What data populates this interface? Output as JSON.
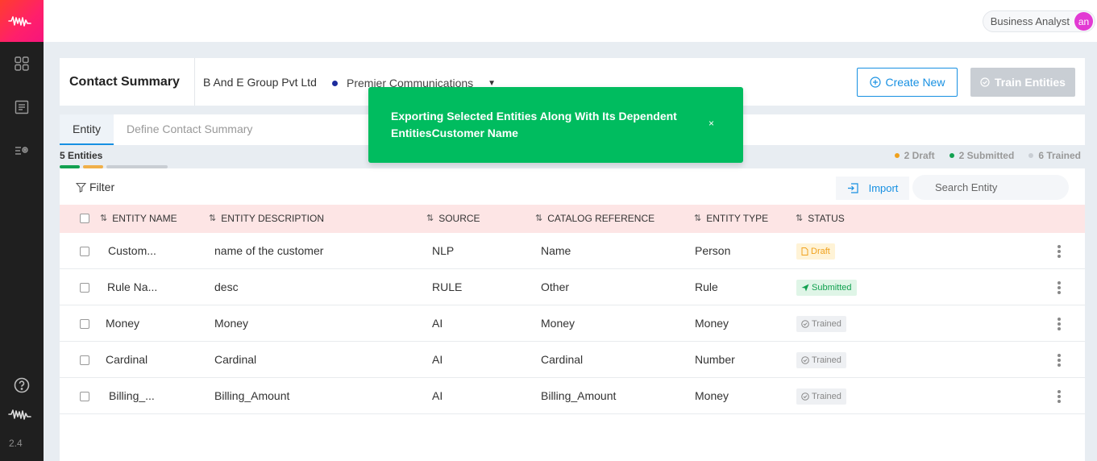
{
  "app": {
    "version": "2.4",
    "user_role": "Business Analyst",
    "avatar_initials": "an"
  },
  "header": {
    "title": "Contact Summary",
    "company": "B And E Group Pvt Ltd",
    "project": "Premier Communications",
    "create_label": "Create New",
    "train_label": "Train Entities"
  },
  "tabs": [
    {
      "label": "Entity",
      "active": true
    },
    {
      "label": "Define Contact Summary",
      "active": false
    }
  ],
  "stats": {
    "entities_label": "5 Entities",
    "draft_label": "2 Draft",
    "submitted_label": "2 Submitted",
    "trained_label": "6 Trained"
  },
  "toolbar": {
    "filter_label": "Filter",
    "import_label": "Import",
    "search_placeholder": "Search Entity"
  },
  "table": {
    "headers": [
      "ENTITY NAME",
      "ENTITY DESCRIPTION",
      "SOURCE",
      "CATALOG REFERENCE",
      "ENTITY TYPE",
      "STATUS"
    ],
    "rows": [
      {
        "name": "Custom...",
        "description": "name of the customer",
        "source": "NLP",
        "catalog": "Name",
        "type": "Person",
        "status": "Draft"
      },
      {
        "name": "Rule Na...",
        "description": "desc",
        "source": "RULE",
        "catalog": "Other",
        "type": "Rule",
        "status": "Submitted"
      },
      {
        "name": "Money",
        "description": "Money",
        "source": "AI",
        "catalog": "Money",
        "type": "Money",
        "status": "Trained"
      },
      {
        "name": "Cardinal",
        "description": "Cardinal",
        "source": "AI",
        "catalog": "Cardinal",
        "type": "Number",
        "status": "Trained"
      },
      {
        "name": "Billing_...",
        "description": "Billing_Amount",
        "source": "AI",
        "catalog": "Billing_Amount",
        "type": "Money",
        "status": "Trained"
      }
    ]
  },
  "toast": {
    "message": "Exporting Selected Entities Along With Its Dependent EntitiesCustomer Name",
    "close_label": "×"
  },
  "colors": {
    "accent": "#1790e2",
    "toast": "#00bc5f",
    "draft": "#f0a11d",
    "submitted": "#12a150",
    "trained": "#c9ced4"
  }
}
